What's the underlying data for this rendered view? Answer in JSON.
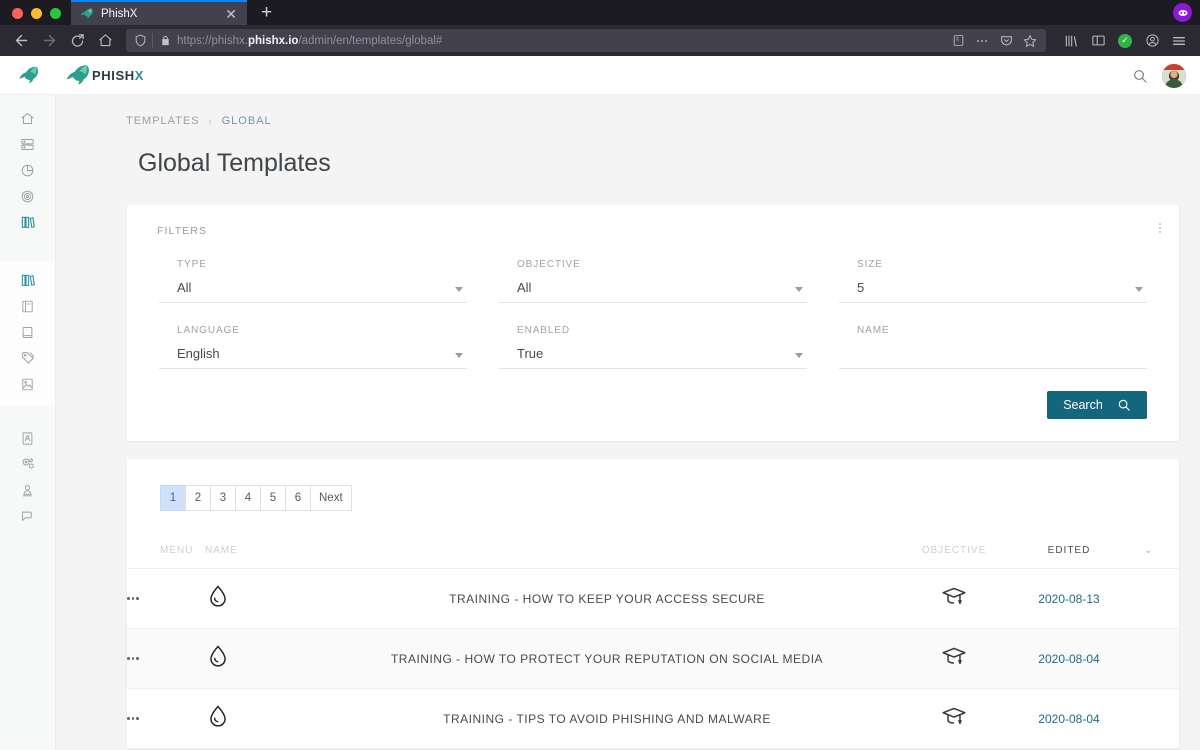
{
  "browser": {
    "tab": {
      "title": "PhishX",
      "favicon": "shark-icon",
      "close": "✕"
    },
    "newtab_label": "+",
    "url": {
      "prefix": "https://phishx.",
      "domain": "phishx.io",
      "path": "/admin/en/templates/global#"
    },
    "icons": {
      "back": "back-arrow-icon",
      "forward": "forward-arrow-icon",
      "reload": "reload-icon",
      "home": "home-icon",
      "shield": "tracking-protection-icon",
      "lock": "padlock-icon",
      "reader": "reader-view-icon",
      "more": "page-actions-icon",
      "pocket": "save-to-pocket-icon",
      "bookmark": "bookmark-star-icon",
      "library": "library-icon",
      "sidebar": "sidebar-icon",
      "sync": "sync-ok-icon",
      "account": "account-icon",
      "menu": "hamburger-menu-icon",
      "extension": "extension-badge-icon"
    }
  },
  "app": {
    "logo_text_main": "PHISH",
    "logo_text_accent": "X",
    "accent_color": "#2a8f9e",
    "search_icon": "search-icon",
    "avatar": "user-avatar"
  },
  "sidebar": {
    "items": [
      {
        "name": "home",
        "active": false
      },
      {
        "name": "campaigns",
        "active": false
      },
      {
        "name": "reports",
        "active": false
      },
      {
        "name": "objectives",
        "active": false
      },
      {
        "name": "templates",
        "active": true
      }
    ],
    "sub_items": [
      {
        "name": "templates-global",
        "active": true
      },
      {
        "name": "templates-pages",
        "active": false
      },
      {
        "name": "templates-landing",
        "active": false
      },
      {
        "name": "templates-tags",
        "active": false
      },
      {
        "name": "templates-media",
        "active": false
      }
    ],
    "bottom_items": [
      {
        "name": "contacts",
        "active": false
      },
      {
        "name": "settings",
        "active": false
      },
      {
        "name": "users",
        "active": false
      },
      {
        "name": "support",
        "active": false
      }
    ]
  },
  "breadcrumb": {
    "parent": "TEMPLATES",
    "separator": "›",
    "current": "GLOBAL"
  },
  "page": {
    "title": "Global Templates"
  },
  "filters": {
    "section_label": "FILTERS",
    "fields": [
      {
        "label": "TYPE",
        "value": "All",
        "type": "select"
      },
      {
        "label": "OBJECTIVE",
        "value": "All",
        "type": "select"
      },
      {
        "label": "SIZE",
        "value": "5",
        "type": "select"
      },
      {
        "label": "LANGUAGE",
        "value": "English",
        "type": "select"
      },
      {
        "label": "ENABLED",
        "value": "True",
        "type": "select"
      },
      {
        "label": "NAME",
        "value": "",
        "type": "text"
      }
    ],
    "search_button": {
      "label": "Search",
      "icon": "search-icon",
      "color": "#14667f"
    },
    "menu_icon": "kebab-vertical-icon"
  },
  "pagination": {
    "pages": [
      "1",
      "2",
      "3",
      "4",
      "5",
      "6"
    ],
    "next_label": "Next",
    "active_page": "1",
    "active_bg": "#cfe1fb",
    "active_fg": "#3c66a8"
  },
  "table": {
    "headers": {
      "menu": "MENU",
      "name": "NAME",
      "objective": "OBJECTIVE",
      "edited": "EDITED",
      "sort_icon": "chevron-down-icon"
    },
    "rows": [
      {
        "menu_icon": "kebab-horizontal-icon",
        "type_icon": "water-drop-icon",
        "name": "TRAINING - HOW TO KEEP YOUR ACCESS SECURE",
        "objective_icon": "graduation-cap-icon",
        "edited": "2020-08-13"
      },
      {
        "menu_icon": "kebab-horizontal-icon",
        "type_icon": "water-drop-icon",
        "name": "TRAINING - HOW TO PROTECT YOUR REPUTATION ON SOCIAL MEDIA",
        "objective_icon": "graduation-cap-icon",
        "edited": "2020-08-04"
      },
      {
        "menu_icon": "kebab-horizontal-icon",
        "type_icon": "water-drop-icon",
        "name": "TRAINING - TIPS TO AVOID PHISHING AND MALWARE",
        "objective_icon": "graduation-cap-icon",
        "edited": "2020-08-04"
      }
    ],
    "date_color": "#1d6e87"
  }
}
